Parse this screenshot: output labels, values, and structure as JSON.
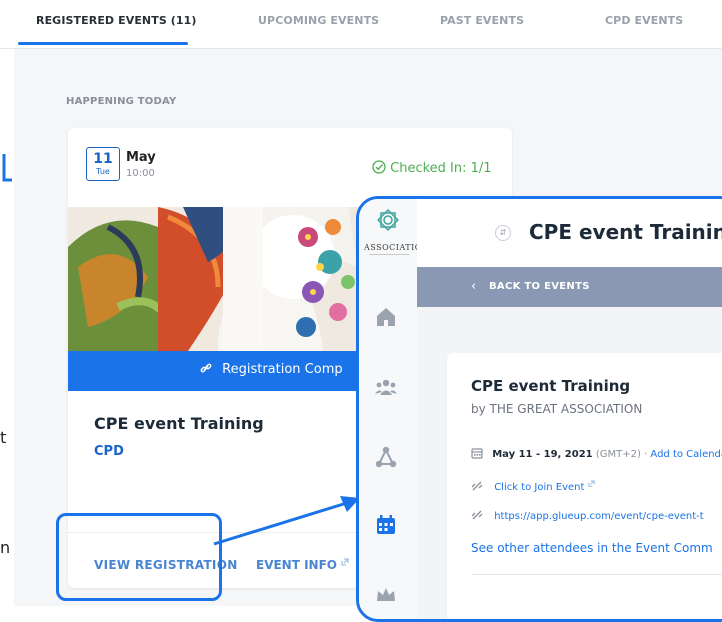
{
  "tabs": [
    {
      "label": "REGISTERED EVENTS (11)",
      "active": true
    },
    {
      "label": "UPCOMING EVENTS",
      "active": false
    },
    {
      "label": "PAST EVENTS",
      "active": false
    },
    {
      "label": "CPD EVENTS",
      "active": false
    }
  ],
  "section_label": "HAPPENING TODAY",
  "event_card": {
    "day": "11",
    "weekday": "Tue",
    "month": "May",
    "time": "10:00",
    "checked_in_label": "Checked In: 1/1",
    "banner_label": "Registration Comp",
    "title": "CPE event Training",
    "type": "CPD",
    "view_registration": "VIEW REGISTRATION",
    "event_info": "EVENT INFO"
  },
  "edge_text": {
    "letter_t": "t",
    "letter_n": "n"
  },
  "overlay": {
    "logo_text": "ASSOCIATION",
    "header_title": "CPE event Training",
    "back_label": "BACK TO EVENTS",
    "event_title": "CPE event Training",
    "by_line": "by THE GREAT ASSOCIATION",
    "date_range": "May 11 - 19, 2021",
    "timezone": "(GMT+2)",
    "separator": "·",
    "add_calendar": "Add to Calenda",
    "join_label": "Click to Join Event",
    "url": "https://app.glueup.com/event/cpe-event-t",
    "see_attendees": "See other attendees in the Event Comm"
  },
  "colors": {
    "accent": "#1a73e8",
    "success": "#4caf50",
    "back_bar": "#8a98b3"
  }
}
